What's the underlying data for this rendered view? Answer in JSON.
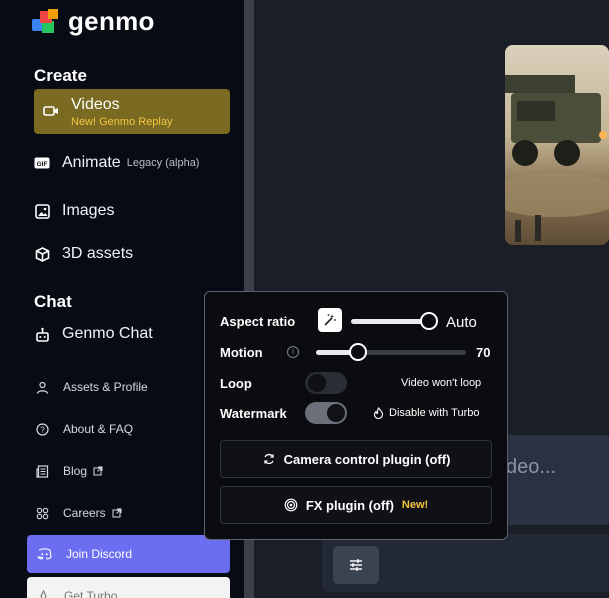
{
  "brand": {
    "name": "genmo"
  },
  "sidebar": {
    "create_heading": "Create",
    "videos": {
      "label": "Videos",
      "sublabel": "New! Genmo Replay"
    },
    "animate": {
      "label": "Animate",
      "tag": "Legacy (alpha)"
    },
    "images": {
      "label": "Images"
    },
    "assets3d": {
      "label": "3D assets"
    },
    "chat_heading": "Chat",
    "genmo_chat": {
      "label": "Genmo Chat"
    },
    "assets_profile": {
      "label": "Assets & Profile"
    },
    "about_faq": {
      "label": "About & FAQ"
    },
    "blog": {
      "label": "Blog"
    },
    "careers": {
      "label": "Careers"
    },
    "discord": {
      "label": "Join Discord"
    },
    "turbo": {
      "label": "Get Turbo"
    }
  },
  "main": {
    "prompt_placeholder": "deo..."
  },
  "popup": {
    "aspect_ratio": {
      "label": "Aspect ratio",
      "value": "Auto",
      "level": 1.0
    },
    "motion": {
      "label": "Motion",
      "value": "70",
      "level": 0.28
    },
    "loop": {
      "label": "Loop",
      "on": false,
      "note": "Video won't loop"
    },
    "watermark": {
      "label": "Watermark",
      "on": true,
      "note": "Disable with Turbo"
    },
    "camera_plugin": {
      "label": "Camera control plugin (off)"
    },
    "fx_plugin": {
      "label": "FX plugin (off)",
      "badge": "New!"
    }
  },
  "colors": {
    "accent_gold": "#f5c542",
    "videos_active_bg": "#7a6a22",
    "discord_purple": "#6b6ef0"
  },
  "icons": [
    "video-camera-icon",
    "gif-icon",
    "image-icon",
    "cube-icon",
    "robot-icon",
    "user-icon",
    "help-circle-icon",
    "newspaper-icon",
    "external-link-icon",
    "network-icon",
    "discord-icon",
    "flame-icon",
    "magic-wand-icon",
    "info-icon",
    "camera-rotate-icon",
    "spiral-icon",
    "sliders-icon"
  ]
}
